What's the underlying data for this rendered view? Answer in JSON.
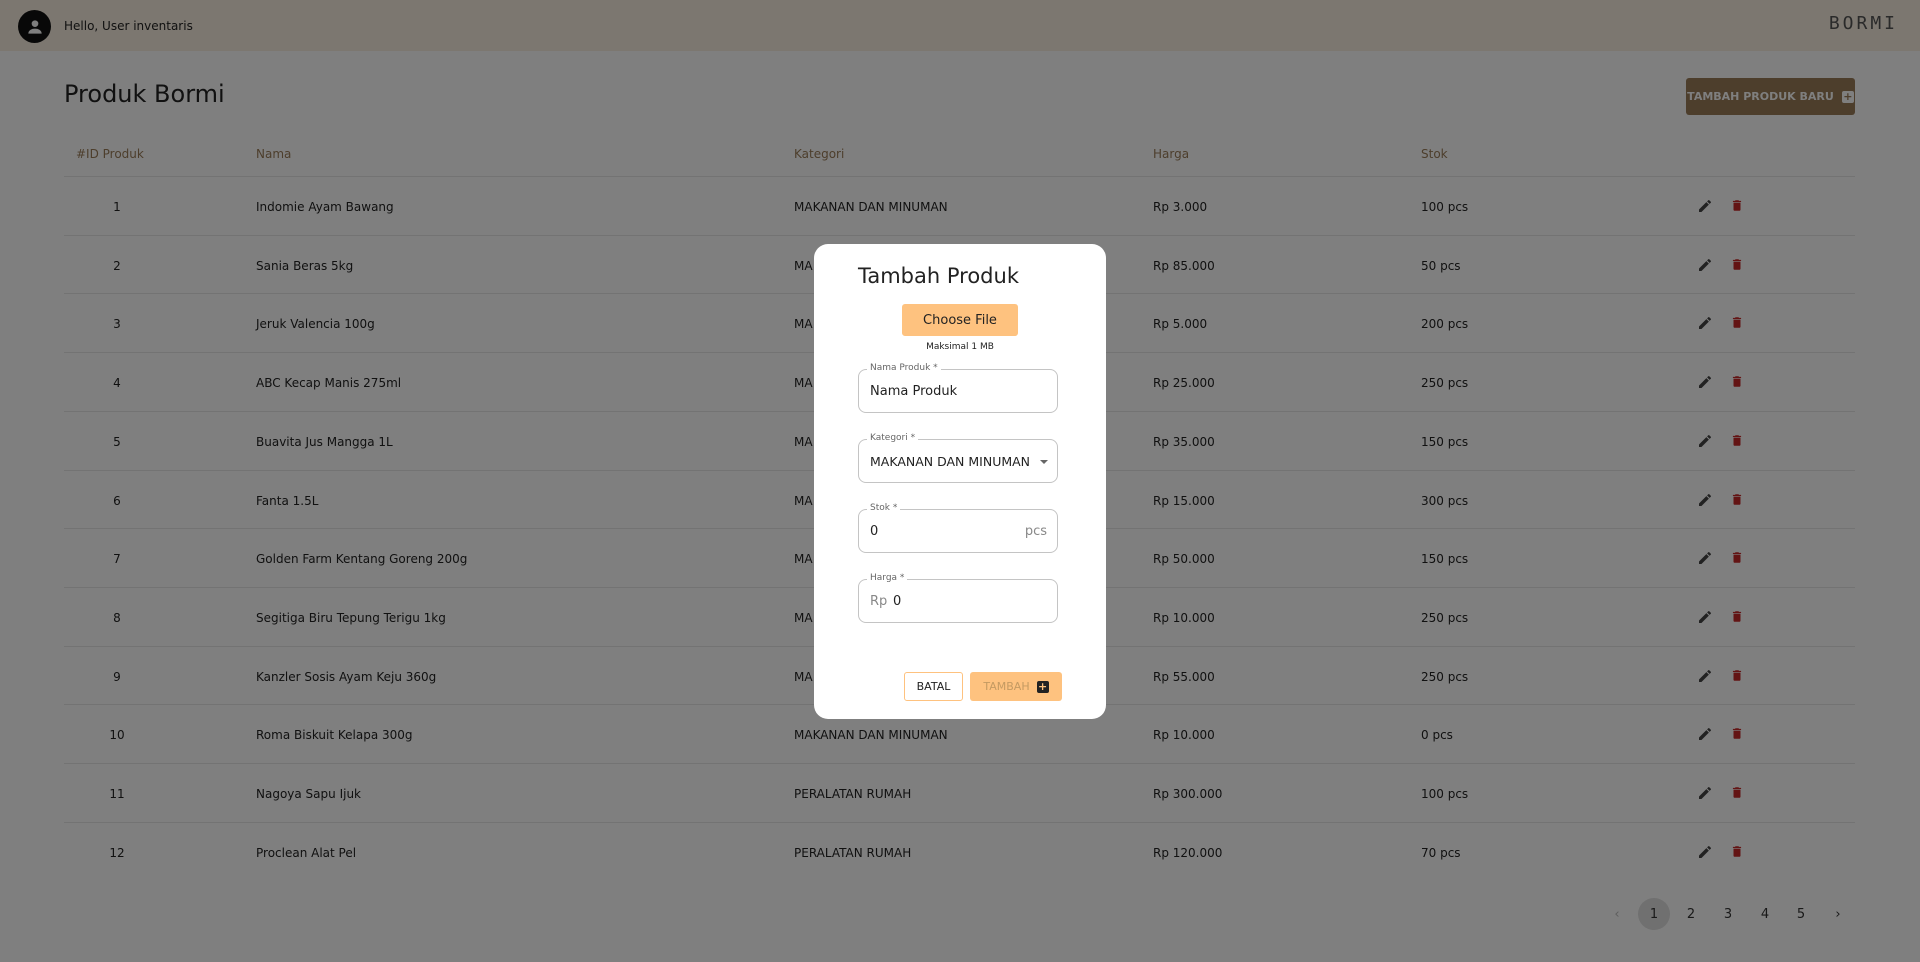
{
  "header": {
    "greeting": "Hello, User inventaris",
    "brand": "BORMI"
  },
  "page": {
    "title": "Produk Bormi",
    "add_button_label": "TAMBAH PRODUK BARU"
  },
  "table": {
    "columns": [
      "#ID Produk",
      "Nama",
      "Kategori",
      "Harga",
      "Stok"
    ],
    "rows": [
      {
        "id": "1",
        "nama": "Indomie Ayam Bawang",
        "kategori": "MAKANAN DAN MINUMAN",
        "harga": "Rp 3.000",
        "stok": "100 pcs"
      },
      {
        "id": "2",
        "nama": "Sania Beras 5kg",
        "kategori": "MA",
        "harga": "Rp 85.000",
        "stok": "50 pcs"
      },
      {
        "id": "3",
        "nama": "Jeruk Valencia 100g",
        "kategori": "MA",
        "harga": "Rp 5.000",
        "stok": "200 pcs"
      },
      {
        "id": "4",
        "nama": "ABC Kecap Manis 275ml",
        "kategori": "MA",
        "harga": "Rp 25.000",
        "stok": "250 pcs"
      },
      {
        "id": "5",
        "nama": "Buavita Jus Mangga 1L",
        "kategori": "MA",
        "harga": "Rp 35.000",
        "stok": "150 pcs"
      },
      {
        "id": "6",
        "nama": "Fanta 1.5L",
        "kategori": "MA",
        "harga": "Rp 15.000",
        "stok": "300 pcs"
      },
      {
        "id": "7",
        "nama": "Golden Farm Kentang Goreng 200g",
        "kategori": "MA",
        "harga": "Rp 50.000",
        "stok": "150 pcs"
      },
      {
        "id": "8",
        "nama": "Segitiga Biru Tepung Terigu 1kg",
        "kategori": "MA",
        "harga": "Rp 10.000",
        "stok": "250 pcs"
      },
      {
        "id": "9",
        "nama": "Kanzler Sosis Ayam Keju 360g",
        "kategori": "MA",
        "harga": "Rp 55.000",
        "stok": "250 pcs"
      },
      {
        "id": "10",
        "nama": "Roma Biskuit Kelapa 300g",
        "kategori": "MAKANAN DAN MINUMAN",
        "harga": "Rp 10.000",
        "stok": "0 pcs"
      },
      {
        "id": "11",
        "nama": "Nagoya Sapu Ijuk",
        "kategori": "PERALATAN RUMAH",
        "harga": "Rp 300.000",
        "stok": "100 pcs"
      },
      {
        "id": "12",
        "nama": "Proclean Alat Pel",
        "kategori": "PERALATAN RUMAH",
        "harga": "Rp 120.000",
        "stok": "70 pcs"
      }
    ]
  },
  "pagination": {
    "pages": [
      "1",
      "2",
      "3",
      "4",
      "5"
    ],
    "current": "1",
    "prev_icon": "chevron-left-icon",
    "next_icon": "chevron-right-icon"
  },
  "modal": {
    "title": "Tambah Produk",
    "choose_file_label": "Choose File",
    "file_note": "Maksimal 1 MB",
    "nama": {
      "label": "Nama Produk *",
      "value": "Nama Produk"
    },
    "kategori": {
      "label": "Kategori *",
      "value": "MAKANAN DAN MINUMAN"
    },
    "stok": {
      "label": "Stok *",
      "value": "0",
      "suffix": "pcs"
    },
    "harga": {
      "label": "Harga *",
      "prefix": "Rp",
      "value": "0"
    },
    "cancel_label": "BATAL",
    "submit_label": "TAMBAH"
  },
  "colors": {
    "accent": "#9a7c58",
    "modal_accent": "#fec27f",
    "delete": "#c62828",
    "header_bg": "#f8efe1"
  }
}
